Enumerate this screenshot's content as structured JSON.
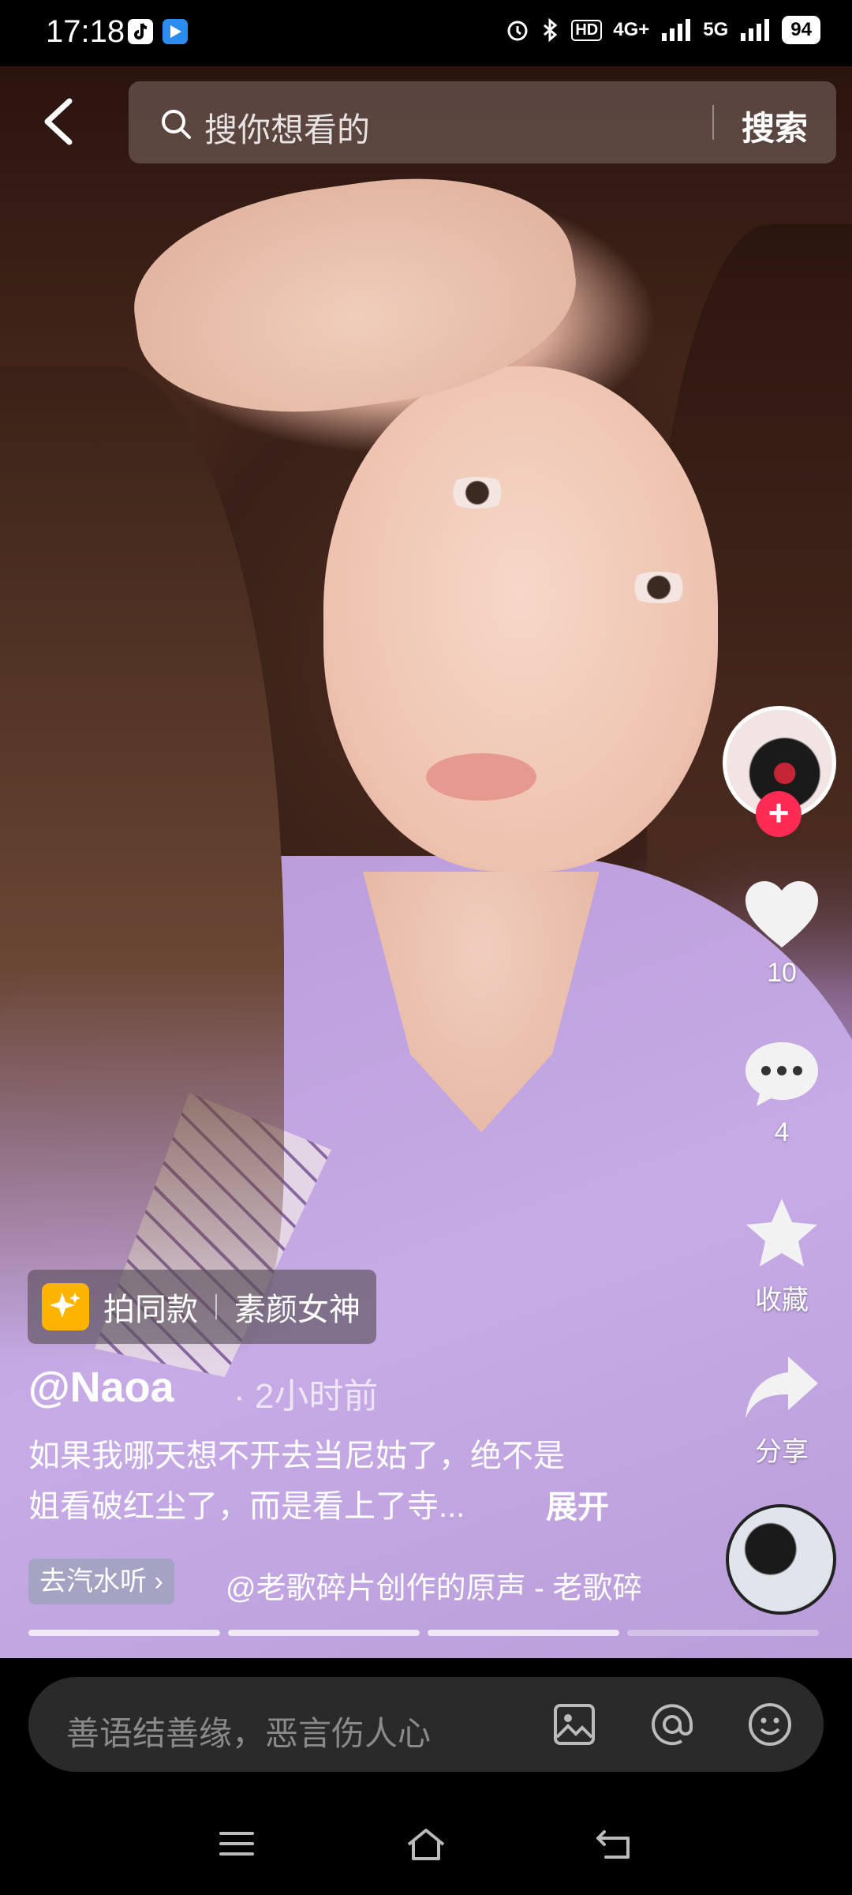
{
  "status_bar": {
    "time": "17:18",
    "network_4g": "4G+",
    "network_5g": "5G",
    "hd": "HD",
    "battery": "94"
  },
  "search": {
    "placeholder": "搜你想看的",
    "button": "搜索"
  },
  "actions": {
    "like_count": "10",
    "comment_count": "4",
    "favorite_label": "收藏",
    "share_label": "分享",
    "follow_symbol": "+"
  },
  "post": {
    "template_label": "拍同款",
    "template_name": "素颜女神",
    "author": "@Naoa",
    "time": "· 2小时前",
    "caption_line1": "如果我哪天想不开去当尼姑了，绝不是",
    "caption_line2": "姐看破红尘了，而是看上了寺...",
    "expand": "展开",
    "qishui_label": "去汽水听 ›",
    "music_title": "@老歌碎片创作的原声 - 老歌碎片"
  },
  "progress": {
    "segments": 4,
    "active_index": 3
  },
  "comment": {
    "placeholder": "善语结善缘，恶言伤人心"
  },
  "colors": {
    "accent": "#fe2c55",
    "template_icon": "#ffb400"
  },
  "icons": [
    "back-icon",
    "search-icon",
    "heart-icon",
    "comment-icon",
    "star-icon",
    "share-icon",
    "image-icon",
    "at-icon",
    "emoji-icon",
    "menu-icon",
    "home-icon",
    "return-icon"
  ]
}
